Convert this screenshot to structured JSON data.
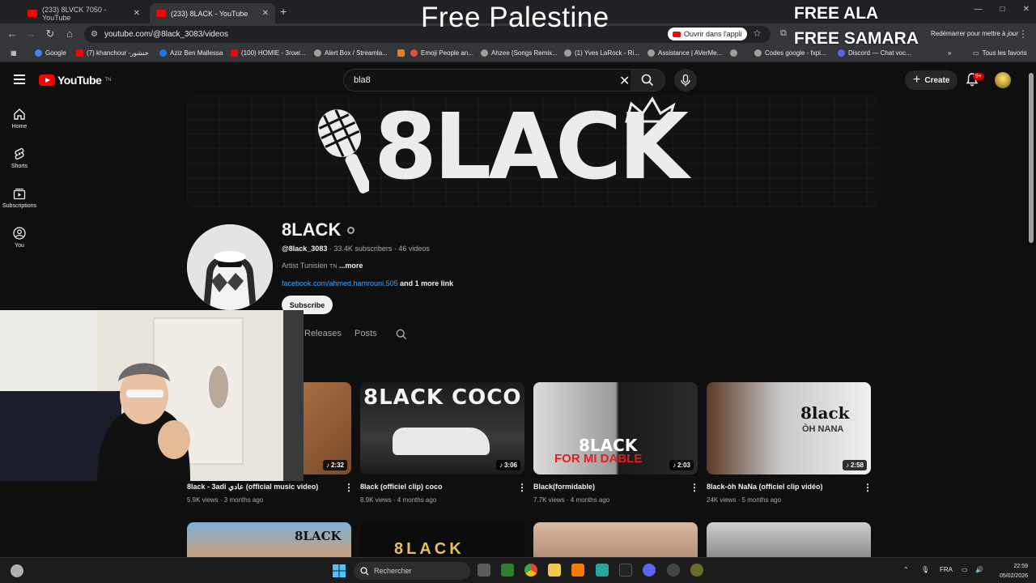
{
  "browser": {
    "tabs": [
      {
        "title": "(233) 8LVCK 7050 - YouTube",
        "active": false
      },
      {
        "title": "(233) 8LACK - YouTube",
        "active": true
      }
    ],
    "url": "youtube.com/@8lack_3083/videos",
    "open_app_label": "Ouvrir dans l'appli",
    "restart_label_a": "Redémarrer pour mettre à ",
    "restart_label_b": "jour",
    "bookmarks": [
      {
        "label": "Google",
        "color": "#4285f4"
      },
      {
        "label": "(7) khanchour -خنشور",
        "color": "#ff0000"
      },
      {
        "label": "Aziz Ben Mallessa",
        "color": "#1877f2"
      },
      {
        "label": "(100) HOMIE - Згоиг...",
        "color": "#ff0000"
      },
      {
        "label": "Alert Box / Streamla...",
        "color": "#9e9e9e"
      },
      {
        "label": "",
        "color": "#e67e22"
      },
      {
        "label": "Emoji People an...",
        "color": "#e74c3c"
      },
      {
        "label": "Ahzee (Songs Remix...",
        "color": "#9e9e9e"
      },
      {
        "label": "(1) Yves LaRock - Ri...",
        "color": "#9e9e9e"
      },
      {
        "label": "Assistance | AVerMe...",
        "color": "#9e9e9e"
      },
      {
        "label": "",
        "color": "#9e9e9e"
      },
      {
        "label": "Codes google - fxpi...",
        "color": "#9e9e9e"
      },
      {
        "label": "Discord — Chat voc...",
        "color": "#5865f2"
      }
    ],
    "all_bookmarks_label": "Tous les favoris"
  },
  "overlay": {
    "title": "Free Palestine",
    "free_line_1": "FREE ALA",
    "free_line_2": "FREE SAMARA"
  },
  "youtube": {
    "logo_text": "YouTube",
    "logo_region": "TN",
    "search_value": "bla8",
    "create_label": "Create",
    "notifications_badge": "9+",
    "guide": [
      {
        "label": "Home",
        "icon": "home-icon"
      },
      {
        "label": "Shorts",
        "icon": "shorts-icon"
      },
      {
        "label": "Subscriptions",
        "icon": "subscriptions-icon"
      },
      {
        "label": "You",
        "icon": "you-icon"
      }
    ]
  },
  "channel": {
    "banner_text": "8LACK",
    "name": "8LACK",
    "handle": "@8lack_3083",
    "subscribers": "33.4K subscribers",
    "videos_count": "46 videos",
    "description": "Artist Tunisien",
    "flag": "TN",
    "more_label": "...more",
    "link_url": "facebook.com/ahmed.hamrouni.505",
    "link_more": "and 1 more link",
    "subscribe_label": "Subscribe",
    "tabs": [
      "Releases",
      "Posts"
    ]
  },
  "videos": [
    {
      "title": "8lack - 3adi عادي (official music video)",
      "views": "5.9K views",
      "age": "3 months ago",
      "duration": "2:32"
    },
    {
      "title": "8lack (officiel clip) coco",
      "views": "8.9K views",
      "age": "4 months ago",
      "duration": "3:06",
      "thumb_text": "8LACK COCO"
    },
    {
      "title": "Black(formidable)",
      "views": "7.7K views",
      "age": "4 months ago",
      "duration": "2:03",
      "thumb_text": "8LACK",
      "thumb_sub": "FOR MI DABLE"
    },
    {
      "title": "8lack-òh NaNa (officiel clip vidéo)",
      "views": "24K views",
      "age": "5 months ago",
      "duration": "2:58",
      "thumb_text": "8lack",
      "thumb_sub": "ÒH NANA"
    }
  ],
  "next_row": [
    {
      "thumb_text": "8LACK"
    },
    {
      "thumb_text": "8LACK"
    }
  ],
  "taskbar": {
    "search_label": "Rechercher",
    "lang": "FRA",
    "time": "22:59",
    "date": "05/02/2026"
  }
}
